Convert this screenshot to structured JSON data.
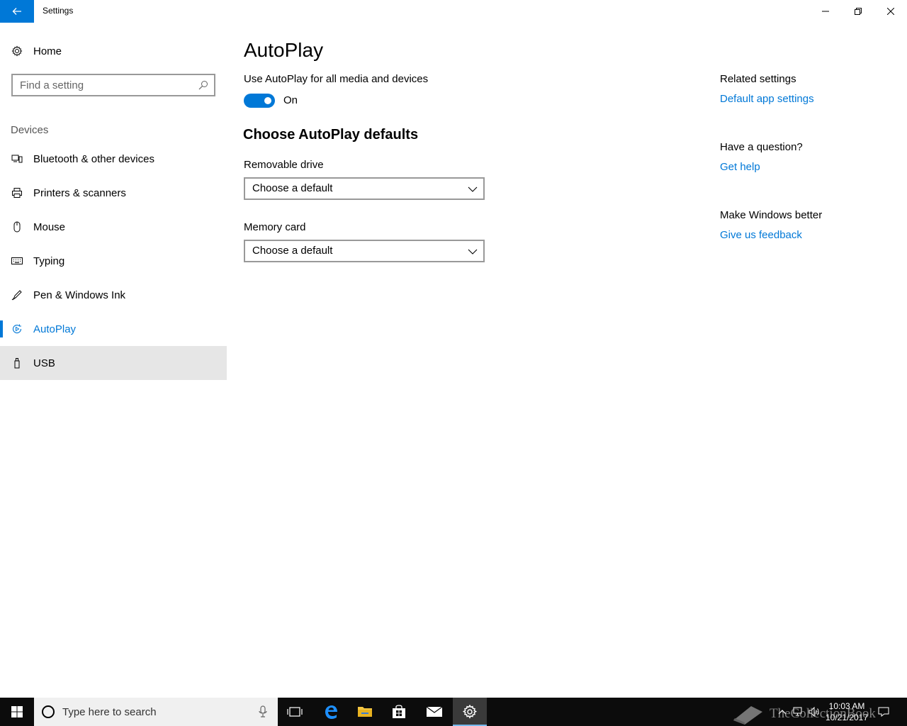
{
  "window": {
    "title": "Settings"
  },
  "sidebar": {
    "home_label": "Home",
    "search_placeholder": "Find a setting",
    "group_label": "Devices",
    "items": [
      {
        "label": "Bluetooth & other devices",
        "icon": "bluetooth-device-icon"
      },
      {
        "label": "Printers & scanners",
        "icon": "printer-icon"
      },
      {
        "label": "Mouse",
        "icon": "mouse-icon"
      },
      {
        "label": "Typing",
        "icon": "keyboard-icon"
      },
      {
        "label": "Pen & Windows Ink",
        "icon": "pen-icon"
      },
      {
        "label": "AutoPlay",
        "icon": "autoplay-icon",
        "selected": true
      },
      {
        "label": "USB",
        "icon": "usb-icon",
        "hovered": true
      }
    ]
  },
  "main": {
    "title": "AutoPlay",
    "toggle_label": "Use AutoPlay for all media and devices",
    "toggle_state": "On",
    "toggle_on": true,
    "section_title": "Choose AutoPlay defaults",
    "removable_drive_label": "Removable drive",
    "removable_drive_value": "Choose a default",
    "memory_card_label": "Memory card",
    "memory_card_value": "Choose a default"
  },
  "related": {
    "related_heading": "Related settings",
    "default_apps_link": "Default app settings",
    "question_heading": "Have a question?",
    "help_link": "Get help",
    "better_heading": "Make Windows better",
    "feedback_link": "Give us feedback"
  },
  "taskbar": {
    "search_placeholder": "Type here to search",
    "time": "10:03 AM",
    "date": "10/21/2017",
    "watermark": "TheCollectionBook"
  },
  "colors": {
    "accent": "#0078d7",
    "taskbar": "#0c0c0c",
    "hover": "#e6e6e6"
  }
}
